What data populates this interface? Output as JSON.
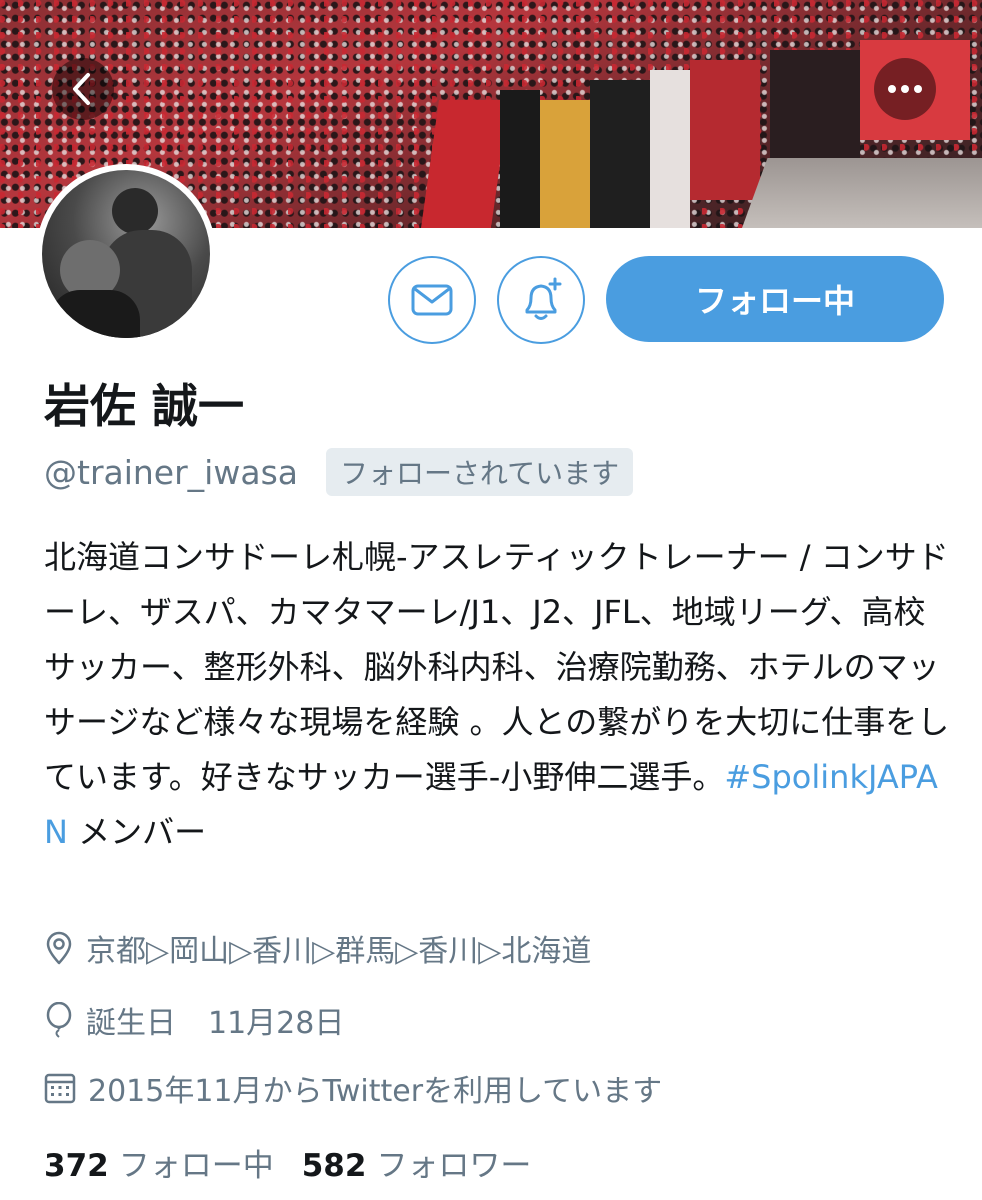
{
  "header": {
    "back_icon": "chevron-left-icon",
    "more_icon": "more-horizontal-icon"
  },
  "actions": {
    "message_icon": "mail-icon",
    "notify_icon": "bell-plus-icon",
    "follow_label": "フォロー中"
  },
  "profile": {
    "name": "岩佐 誠一",
    "handle": "@trainer_iwasa",
    "follows_you": "フォローされています",
    "bio_before_tag": "北海道コンサドーレ札幌-アスレティックトレーナー / コンサドーレ、ザスパ、カマタマーレ/J1、J2、JFL、地域リーグ、高校サッカー、整形外科、脳外科内科、治療院勤務、ホテルのマッサージなど様々な現場を経験 。人との繋がりを大切に仕事をしています。好きなサッカー選手-小野伸二選手。",
    "bio_tag": "#SpolinkJAPAN",
    "bio_after_tag": " メンバー",
    "location": "京都▷岡山▷香川▷群馬▷香川▷北海道",
    "birthday_label": "誕生日",
    "birthday_value": "11月28日",
    "joined": "2015年11月からTwitterを利用しています"
  },
  "stats": {
    "following_count": "372",
    "following_label": "フォロー中",
    "followers_count": "582",
    "followers_label": "フォロワー"
  },
  "colors": {
    "accent": "#4a9de0",
    "muted": "#657786",
    "text": "#14171a"
  }
}
